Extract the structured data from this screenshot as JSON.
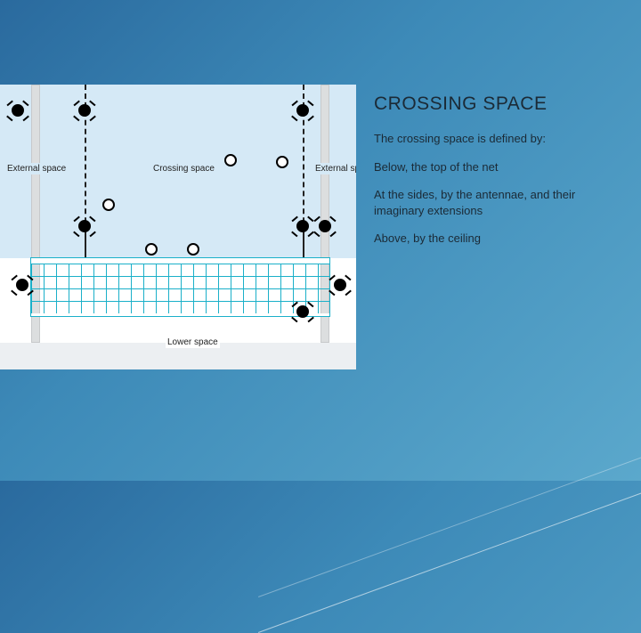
{
  "title": "CROSSING SPACE",
  "body": {
    "intro": "The crossing space is defined by:",
    "p1": "Below, the top of the net",
    "p2": "At the sides, by the antennae, and their imaginary extensions",
    "p3": "Above, by the ceiling"
  },
  "diagram": {
    "crossing_label": "Crossing space",
    "external_left_label": "External space",
    "external_right_label": "External space",
    "lower_label": "Lower space"
  }
}
